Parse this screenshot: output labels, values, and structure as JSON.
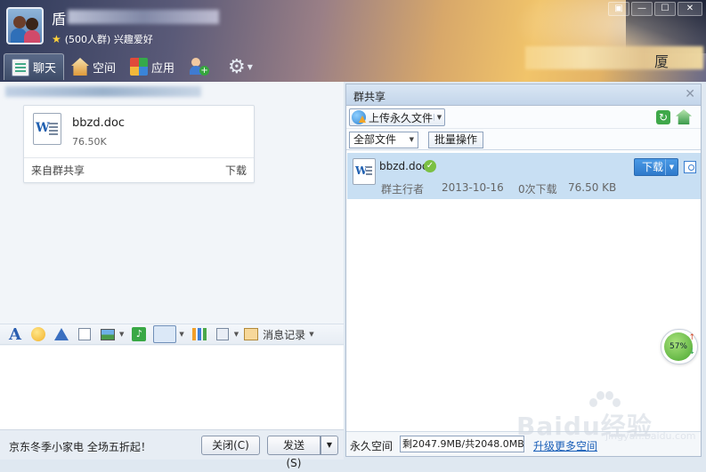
{
  "header": {
    "group_name_visible": "盾",
    "member_info": "(500人群) 兴趣爱好",
    "right_banner_mark": "厦",
    "window_buttons": [
      "▣",
      "—",
      "☐",
      "✕"
    ]
  },
  "tabs": [
    {
      "label": "聊天",
      "icon": "chat-icon",
      "active": true
    },
    {
      "label": "空间",
      "icon": "home-icon"
    },
    {
      "label": "应用",
      "icon": "apps-icon"
    }
  ],
  "chat": {
    "file_card": {
      "file_name": "bbzd.doc",
      "file_size": "76.50K",
      "source": "来自群共享",
      "download": "下载"
    },
    "toolbar": {
      "history_label": "消息记录"
    },
    "ad_text": "京东冬季小家电 全场五折起！",
    "close_button": "关闭(C)",
    "send_button": "发送(S)"
  },
  "share_panel": {
    "title": "群共享",
    "upload_label": "上传永久文件",
    "filter_select": "全部文件",
    "batch_button": "批量操作",
    "files": [
      {
        "name": "bbzd.doc",
        "uploader": "群主行者",
        "date": "2013-10-16",
        "downloads": "0次下载",
        "size": "76.50 KB",
        "download_button": "下载"
      }
    ],
    "footer": {
      "label": "永久空间",
      "quota": "剩2047.9MB/共2048.0MB",
      "upgrade_link": "升级更多空间"
    }
  },
  "network_gauge": "57%",
  "watermark": {
    "brand": "Baidu经验",
    "site": "jingyan.baidu.com"
  }
}
